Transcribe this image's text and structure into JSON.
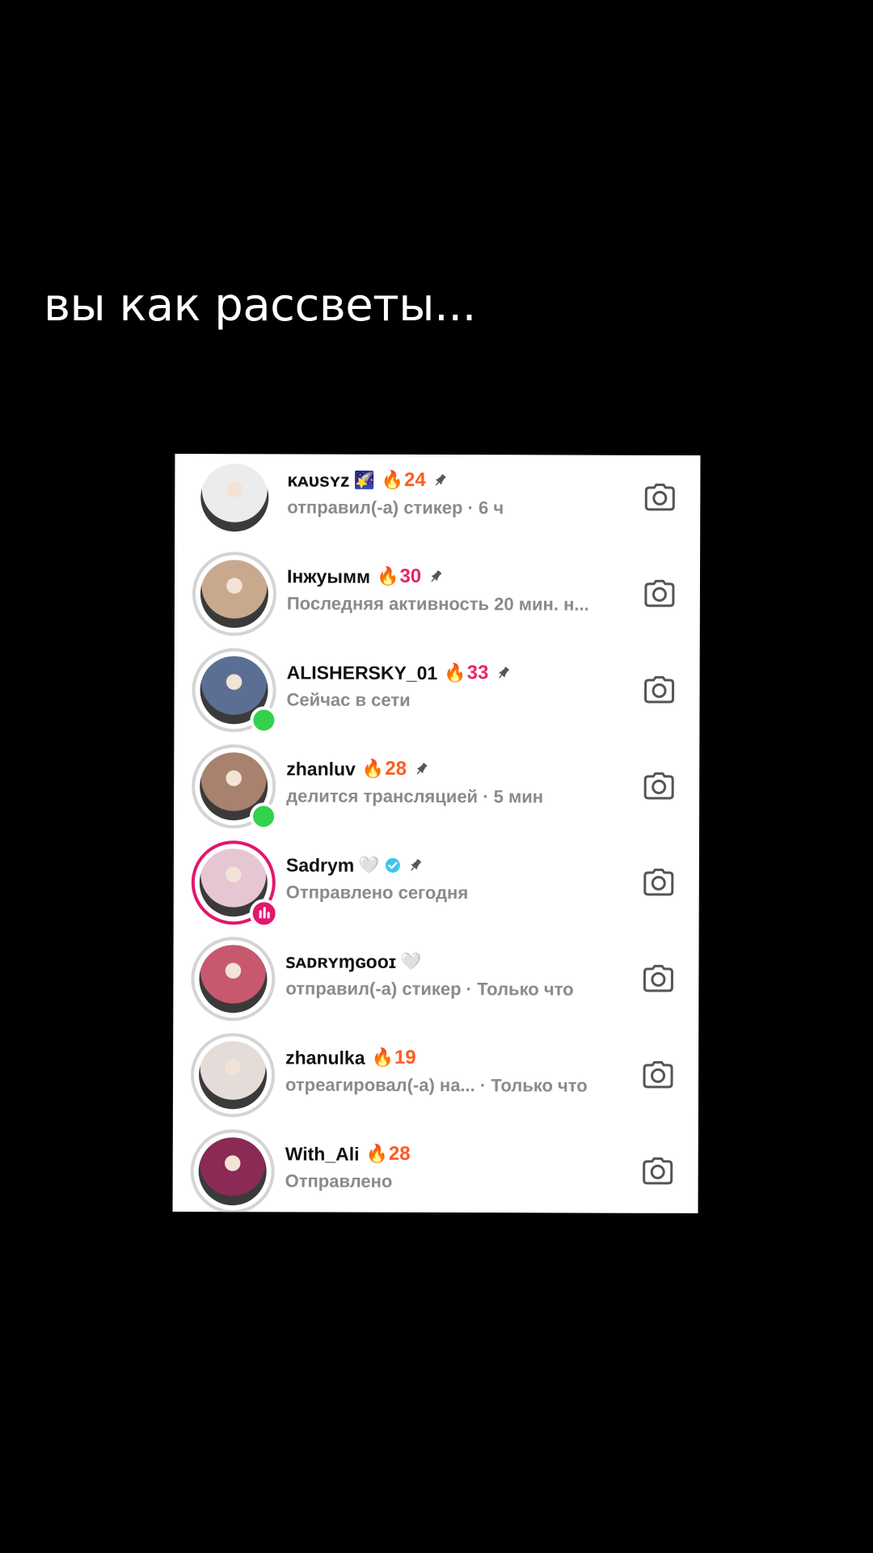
{
  "caption": "вы как рассветы...",
  "chats": [
    {
      "name": "ĸᴀᴜѕʏᴢ",
      "emoji": "🌠",
      "streak": "24",
      "streak_color": "#ff5a1e",
      "pinned": true,
      "verified": false,
      "status": "отправил(-а) стикер · 6 ч",
      "ring": "none",
      "badge": "none",
      "photo": "#ececec"
    },
    {
      "name": "Інжуымм",
      "emoji": "",
      "streak": "30",
      "streak_color": "#e8275f",
      "pinned": true,
      "verified": false,
      "status": "Последняя активность 20 мин. н...",
      "ring": "gray",
      "badge": "none",
      "photo": "#c9a98e"
    },
    {
      "name": "ALISHERSKY_01",
      "emoji": "",
      "streak": "33",
      "streak_color": "#e8275f",
      "pinned": true,
      "verified": false,
      "status": "Сейчас в сети",
      "ring": "gray",
      "badge": "online",
      "photo": "#5a6f93"
    },
    {
      "name": "zhanluv",
      "emoji": "",
      "streak": "28",
      "streak_color": "#ff5a1e",
      "pinned": true,
      "verified": false,
      "status": "делится трансляцией · 5 мин",
      "ring": "gray",
      "badge": "online",
      "photo": "#a8826e"
    },
    {
      "name": "Sadrym",
      "emoji": "🤍",
      "streak": "",
      "streak_color": "",
      "pinned": true,
      "verified": true,
      "status": "Отправлено сегодня",
      "ring": "pink",
      "badge": "live",
      "photo": "#e6c6d2"
    },
    {
      "name": "ꜱᴀᴅʀʏɱɢᴏᴏɪ",
      "emoji": "🤍",
      "streak": "",
      "streak_color": "",
      "pinned": false,
      "verified": false,
      "status": "отправил(-а) стикер · Только что",
      "ring": "gray",
      "badge": "none",
      "photo": "#c8586e"
    },
    {
      "name": "zhanulka",
      "emoji": "",
      "streak": "19",
      "streak_color": "#ff5a1e",
      "pinned": false,
      "verified": false,
      "status": "отреагировал(-а) на...   · Только что",
      "ring": "gray",
      "badge": "none",
      "photo": "#e4dcd8"
    },
    {
      "name": "With_Ali",
      "emoji": "",
      "streak": "28",
      "streak_color": "#ff5a1e",
      "pinned": false,
      "verified": false,
      "status": "Отправлено",
      "ring": "gray",
      "badge": "none",
      "photo": "#8a2a55"
    }
  ],
  "icons": {
    "streak": "fire-emoji",
    "pin": "pin-icon",
    "verified": "verified-badge-icon",
    "camera": "camera-icon"
  },
  "colors": {
    "background": "#000000",
    "panel": "#ffffff",
    "status_text": "#8a8a8e",
    "online": "#33d24b",
    "live": "#e3176d",
    "verified": "#3897f0"
  }
}
